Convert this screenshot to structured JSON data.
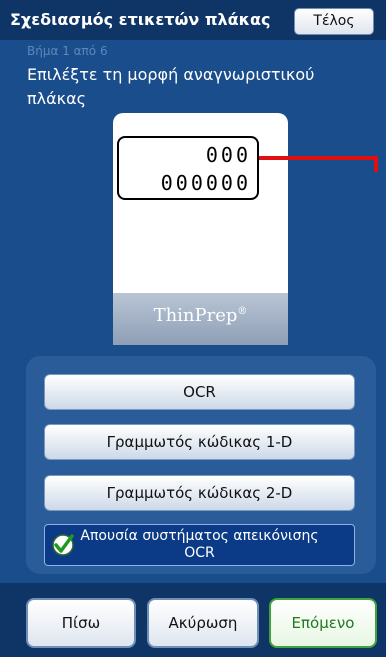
{
  "window": {
    "title": "Σχεδιασμός ετικετών πλάκας",
    "done_label": "Τέλος"
  },
  "wizard": {
    "step_text": "Βήμα 1 από 6",
    "instruction": "Επιλέξτε τη μορφή αναγνωριστικού πλάκας"
  },
  "slide_preview": {
    "label_line1": "000",
    "label_line2": "000000",
    "brand": "ThinPrep",
    "brand_mark": "®"
  },
  "options": {
    "ocr": "OCR",
    "barcode_1d": "Γραμμωτός κώδικας 1-D",
    "barcode_2d": "Γραμμωτός κώδικας 2-D",
    "no_ocr": "Απουσία συστήματος απεικόνισης OCR",
    "selected": "no_ocr"
  },
  "nav": {
    "back_label": "Πίσω",
    "cancel_label": "Ακύρωση",
    "next_label": "Επόμενο"
  },
  "colors": {
    "background": "#1a4d8c",
    "titlebar": "#0e3566",
    "selected_option": "#0b3a86",
    "pointer": "#e01010",
    "next_accent": "#40a43a"
  }
}
